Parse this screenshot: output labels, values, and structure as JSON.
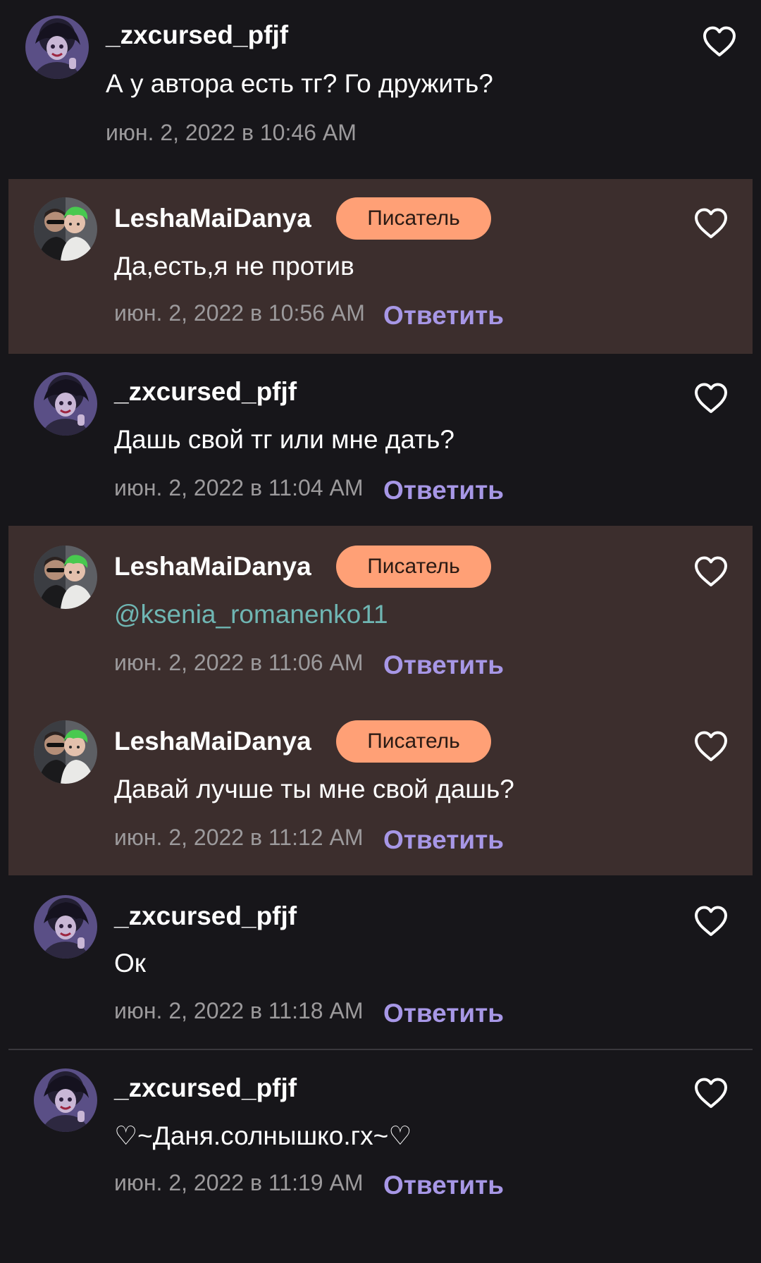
{
  "colors": {
    "background": "#17161a",
    "highlight_background": "#3c2e2d",
    "badge_background": "#ffa076",
    "reply_link": "#a797e6",
    "mention": "#6fb6b3",
    "timestamp": "#9c9a9c"
  },
  "heart_icon": "heart-outline-icon",
  "comments": [
    {
      "username": "_zxcursed_pfjf",
      "text": "А у автора есть тг? Го дружить?",
      "timestamp": "июн. 2, 2022 в 10:46 AM"
    },
    {
      "username": "LeshaMaiDanya",
      "badge": "Писатель",
      "text": "Да,есть,я не против",
      "timestamp": "июн. 2, 2022 в 10:56 AM",
      "reply": "Ответить"
    },
    {
      "username": "_zxcursed_pfjf",
      "text": "Дашь свой тг или мне дать?",
      "timestamp": "июн. 2, 2022 в 11:04 AM",
      "reply": "Ответить"
    },
    {
      "username": "LeshaMaiDanya",
      "badge": "Писатель",
      "text": "@ksenia_romanenko11",
      "timestamp": "июн. 2, 2022 в 11:06 AM",
      "reply": "Ответить"
    },
    {
      "username": "LeshaMaiDanya",
      "badge": "Писатель",
      "text": "Давай лучше ты мне свой дашь?",
      "timestamp": "июн. 2, 2022 в 11:12 AM",
      "reply": "Ответить"
    },
    {
      "username": "_zxcursed_pfjf",
      "text": "Ок",
      "timestamp": "июн. 2, 2022 в 11:18 AM",
      "reply": "Ответить"
    },
    {
      "username": "_zxcursed_pfjf",
      "text": "♡~Даня.солнышко.гх~♡",
      "timestamp": "июн. 2, 2022 в 11:19 AM",
      "reply": "Ответить"
    }
  ]
}
